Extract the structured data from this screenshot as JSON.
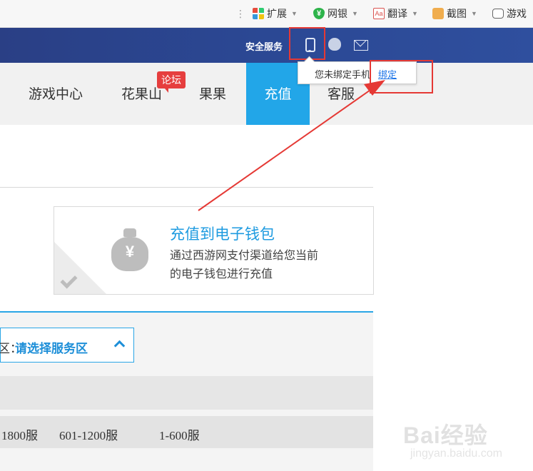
{
  "toolbar": {
    "items": [
      {
        "label": "扩展",
        "icon": "extensions-icon"
      },
      {
        "label": "网银",
        "icon": "bank-shield-icon"
      },
      {
        "label": "翻译",
        "icon": "translate-icon"
      },
      {
        "label": "截图",
        "icon": "screenshot-icon"
      },
      {
        "label": "游戏",
        "icon": "gamepad-icon"
      }
    ]
  },
  "header": {
    "security_label": "安全服务"
  },
  "tooltip": {
    "text": "您未绑定手机",
    "link": "绑定"
  },
  "nav": {
    "items": [
      "游戏中心",
      "花果山",
      "果果",
      "充值",
      "客服"
    ],
    "active": "充值",
    "badge": "论坛"
  },
  "card": {
    "title": "充值到电子钱包",
    "desc_line1": "通过西游网支付渠道给您当前",
    "desc_line2": "的电子钱包进行充值"
  },
  "server_select": {
    "label_fragment": "区：",
    "value": "请选择服务区"
  },
  "servers": [
    "1800服",
    "601-1200服",
    "1-600服"
  ],
  "watermark": {
    "brand": "Bai经验",
    "url": "jingyan.baidu.com"
  },
  "colors": {
    "accent": "#22a6e8",
    "header": "#2b4894",
    "highlight": "#e53935",
    "badge": "#e63e3e"
  }
}
